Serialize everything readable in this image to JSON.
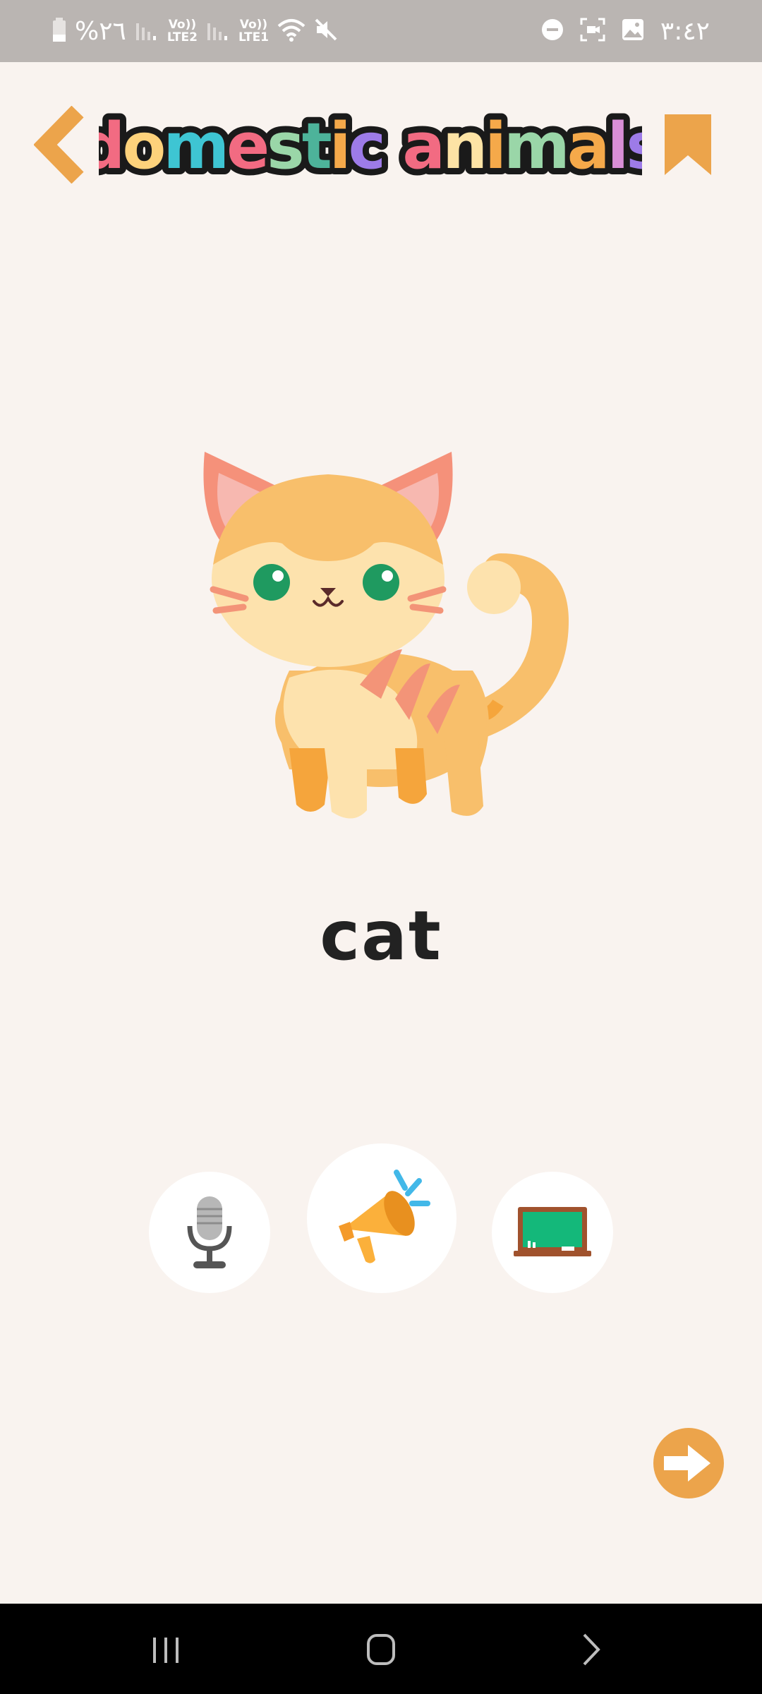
{
  "status_bar": {
    "battery": "%٢٦",
    "sim2_label": "Vo))\nLTE2",
    "sim1_label": "Vo))\nLTE1",
    "time": "٣:٤٢"
  },
  "header": {
    "title": "domestic animals",
    "title_letter_colors": [
      "#f26b82",
      "#fdd27b",
      "#3ec5d3",
      "#f26b82",
      "#9ad6a8",
      "#4db39a",
      "#f5a94a",
      "#9d7be8",
      "#f26b82",
      "#fde3a5",
      "#f5a94a",
      "#9ad6a8",
      "#f5a94a",
      "#d98fd6",
      "#9d7be8",
      "#f26b82"
    ],
    "accent_color": "#eca44b"
  },
  "main": {
    "word": "cat",
    "image_icon": "cat-illustration"
  },
  "actions": {
    "mic_icon": "microphone-icon",
    "speak_icon": "megaphone-icon",
    "board_icon": "chalkboard-icon",
    "next_icon": "arrow-right-icon"
  },
  "nav": {
    "recent_icon": "recent-apps-icon",
    "home_icon": "home-icon",
    "back_icon": "back-icon"
  }
}
